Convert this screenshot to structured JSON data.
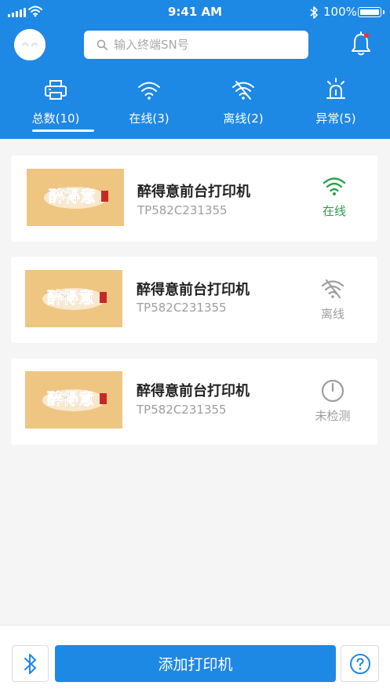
{
  "status_bar": {
    "time": "9:41 AM",
    "battery": "100%",
    "signal_icon": "cellular-signal-icon",
    "wifi_icon": "wifi-icon",
    "bluetooth_icon": "bluetooth-icon"
  },
  "header": {
    "search_placeholder": "输入终端SN号",
    "avatar_icon": "user-avatar-icon",
    "notification_icon": "bell-icon",
    "notification_badge_color": "#e53935",
    "tabs": [
      {
        "label": "总数(10)",
        "icon": "printer-icon",
        "active": true
      },
      {
        "label": "在线(3)",
        "icon": "wifi-icon",
        "active": false
      },
      {
        "label": "离线(2)",
        "icon": "wifi-off-icon",
        "active": false
      },
      {
        "label": "异常(5)",
        "icon": "alarm-light-icon",
        "active": false
      }
    ]
  },
  "devices": [
    {
      "logo_text": "醉得意",
      "name": "醉得意前台打印机",
      "sn": "TP582C231355",
      "status": "在线",
      "status_icon": "wifi-icon",
      "status_color": "#2ca24b"
    },
    {
      "logo_text": "醉得意",
      "name": "醉得意前台打印机",
      "sn": "TP582C231355",
      "status": "离线",
      "status_icon": "wifi-off-icon",
      "status_color": "#9e9e9e"
    },
    {
      "logo_text": "醉得意",
      "name": "醉得意前台打印机",
      "sn": "TP582C231355",
      "status": "未检测",
      "status_icon": "gauge-icon",
      "status_color": "#9e9e9e"
    }
  ],
  "bottom": {
    "add_label": "添加打印机",
    "bluetooth_icon": "bluetooth-icon",
    "help_icon": "help-icon"
  },
  "colors": {
    "primary": "#1e88e5",
    "logo_bg": "#eec682",
    "online": "#2ca24b",
    "offline": "#9e9e9e"
  }
}
